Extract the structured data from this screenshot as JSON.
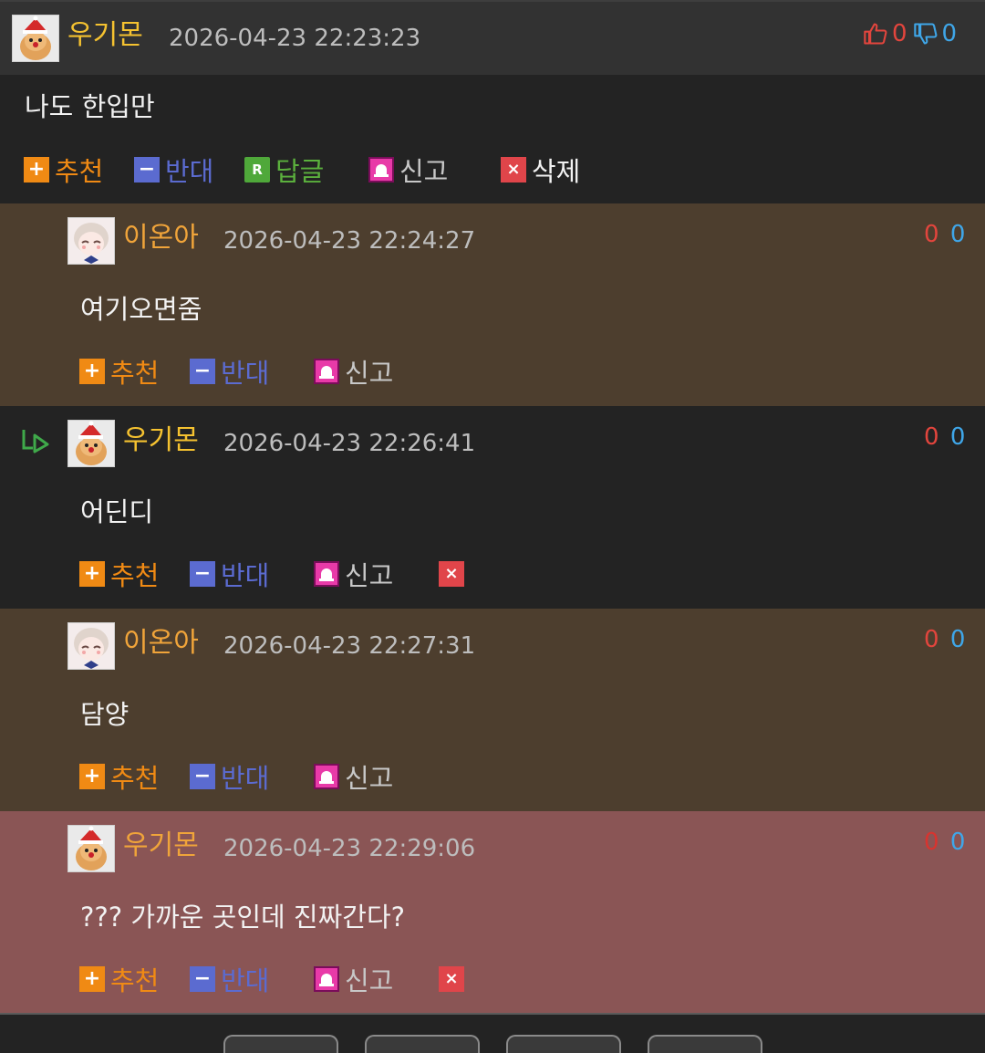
{
  "post": {
    "author": "우기몬",
    "timestamp": "2026-04-23 22:23:23",
    "up_count": "0",
    "down_count": "0",
    "content": "나도 한입만",
    "actions": {
      "recommend": "추천",
      "oppose": "반대",
      "reply": "답글",
      "reply_icon": "R",
      "report": "신고",
      "delete": "삭제"
    }
  },
  "comments": [
    {
      "author": "이온아",
      "timestamp": "2026-04-23 22:24:27",
      "up": "0",
      "down": "0",
      "content": "여기오면줌",
      "actions": {
        "recommend": "추천",
        "oppose": "반대",
        "report": "신고"
      }
    },
    {
      "author": "우기몬",
      "timestamp": "2026-04-23 22:26:41",
      "up": "0",
      "down": "0",
      "content": "어딘디",
      "actions": {
        "recommend": "추천",
        "oppose": "반대",
        "report": "신고"
      }
    },
    {
      "author": "이온아",
      "timestamp": "2026-04-23 22:27:31",
      "up": "0",
      "down": "0",
      "content": "담양",
      "actions": {
        "recommend": "추천",
        "oppose": "반대",
        "report": "신고"
      }
    },
    {
      "author": "우기몬",
      "timestamp": "2026-04-23 22:29:06",
      "up": "0",
      "down": "0",
      "content": "??? 가까운 곳인데 진짜간다?",
      "actions": {
        "recommend": "추천",
        "oppose": "반대",
        "report": "신고"
      }
    }
  ],
  "icons": {
    "plus": "+",
    "minus": "−",
    "delete": "×"
  },
  "colors": {
    "recommend": "#f08a14",
    "oppose": "#5b6bd0",
    "reply": "#5bb03d",
    "report": "#e83aa8",
    "delete": "#e0454a",
    "vote_up": "#e2453d",
    "vote_down": "#3fa6e8"
  }
}
